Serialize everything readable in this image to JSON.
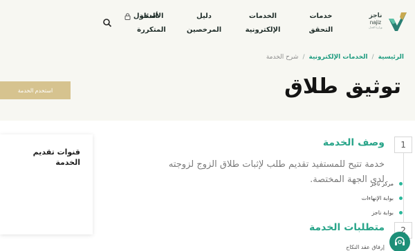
{
  "header": {
    "logo": {
      "ar": "ناجز",
      "en": "najiz",
      "sub": "وزارة العدل"
    },
    "nav": [
      {
        "label": "خدمات التحقق"
      },
      {
        "label": "الخدمات الإلكترونية"
      },
      {
        "label": "دليل المرخصين"
      },
      {
        "label": "الأسئلة المتكررة"
      }
    ],
    "login_label": "الدخول"
  },
  "breadcrumb": {
    "home": "الرئيسية",
    "section": "الخدمات الإلكترونية",
    "current": "شرح الخدمة",
    "separator": "/"
  },
  "page": {
    "title": "توثيق طلاق",
    "use_service_label": "استخدم الخدمة"
  },
  "channels": {
    "title": "قنوات تقديم الخدمة",
    "items": [
      {
        "label": "مركز ناجز"
      },
      {
        "label": "بوابة الإنهاءات"
      },
      {
        "label": "بوابة ناجز"
      }
    ]
  },
  "sections": [
    {
      "number": "1",
      "title": "وصف الخدمة",
      "text": "خدمة تتيح للمستفيد تقديم طلب لإثبات طلاق الزوج لزوجته لدى الجهة المختصة."
    },
    {
      "number": "2",
      "title": "متطلبات الخدمة",
      "first_item": "إرفاق عقد النكاح"
    }
  ],
  "colors": {
    "accent_green": "#2aa58a",
    "gold_button": "#d6c38f",
    "background": "#f7f7f2"
  }
}
